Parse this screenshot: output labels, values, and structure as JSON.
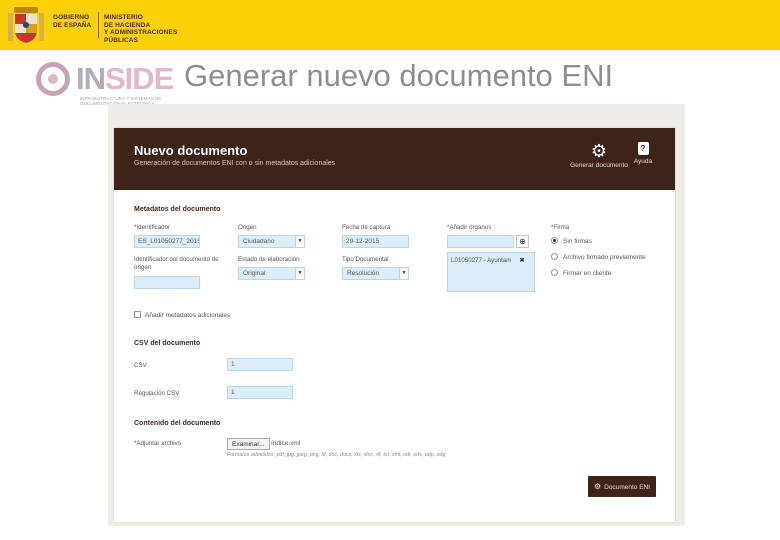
{
  "banner": {
    "gov_line1": "GOBIERNO",
    "gov_line2": "DE ESPAÑA",
    "ministry_line1": "MINISTERIO",
    "ministry_line2": "DE HACIENDA",
    "ministry_line3": "Y ADMINISTRACIONES PÚBLICAS",
    "color": "#fcd10a"
  },
  "inside": {
    "logo_part1": "IN",
    "logo_part2": "SIDE",
    "tagline": "INFRAESTRUCTURA Y SISTEMAS DE DOCUMENTACIÓN ELECTRÓNICA"
  },
  "slide_title": "Generar nuevo documento ENI",
  "app": {
    "header_color": "#3d2318",
    "title": "Nuevo documento",
    "subtitle": "Generación de documentos ENI con o sin metadatos adicionales",
    "generate_icon": "gear-icon",
    "generate_label": "Generar documento",
    "help_icon": "question-icon",
    "help_label": "Ayuda"
  },
  "metadata": {
    "section_title": "Metadatos del documento",
    "identifier_label": "*Identificador",
    "identifier_value": "ES_L01050277_2015_",
    "origin_label": "Origen",
    "origin_value": "Ciudadano",
    "capture_date_label": "Fecha de captura",
    "capture_date_value": "29-12-2015",
    "add_organs_label": "*Añadir órganos",
    "add_organs_value": "",
    "organ_tag": "L01050277 - Ayuntam",
    "signature_label": "*Firma",
    "radio_no_signature": "Sin firmas",
    "radio_presigned": "Archivo firmado previamente",
    "radio_client": "Firmar en cliente",
    "origin_doc_id_label": "Identificador del documento de origen",
    "origin_doc_id_value": "",
    "elaboration_state_label": "Estado de elaboración",
    "elaboration_state_value": "Original",
    "doc_type_label": "Tipo Documental",
    "doc_type_value": "Resolución",
    "additional_metadata_label": "Añadir metadatos adicionales"
  },
  "csv": {
    "section_title": "CSV del documento",
    "csv_label": "CSV",
    "csv_value": "1",
    "regulation_label": "Regulación CSV",
    "regulation_value": "1"
  },
  "content": {
    "section_title": "Contenido del documento",
    "attach_label": "*Adjuntar archivo",
    "browse_label": "Examinar...",
    "file_name": "índice.xml",
    "formats_hint": "Formatos admitidos: pdf, jpg, jpeg, png, tif, doc, docx, xls, xlsx, rtf, txt, xml, odt, ods, odp, odg",
    "submit_label": "Documento ENI",
    "submit_icon": "gear-icon"
  }
}
